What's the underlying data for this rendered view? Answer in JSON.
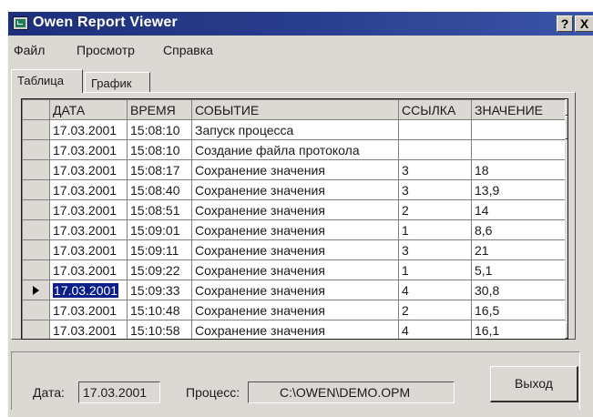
{
  "window": {
    "title": "Owen Report Viewer"
  },
  "titlebar_buttons": {
    "help": "?",
    "close": "X"
  },
  "menu": [
    "Файл",
    "Просмотр",
    "Справка"
  ],
  "tabs": [
    "Таблица",
    "График"
  ],
  "grid": {
    "columns": [
      "ДАТА",
      "ВРЕМЯ",
      "СОБЫТИЕ",
      "ССЫЛКА",
      "ЗНАЧЕНИЕ"
    ],
    "rows": [
      [
        "17.03.2001",
        "15:08:10",
        "Запуск процесса",
        "",
        ""
      ],
      [
        "17.03.2001",
        "15:08:10",
        "Создание файла протокола",
        "",
        ""
      ],
      [
        "17.03.2001",
        "15:08:17",
        "Сохранение значения",
        "3",
        "18"
      ],
      [
        "17.03.2001",
        "15:08:40",
        "Сохранение значения",
        "3",
        "13,9"
      ],
      [
        "17.03.2001",
        "15:08:51",
        "Сохранение значения",
        "2",
        "14"
      ],
      [
        "17.03.2001",
        "15:09:01",
        "Сохранение значения",
        "1",
        "8,6"
      ],
      [
        "17.03.2001",
        "15:09:11",
        "Сохранение значения",
        "3",
        "21"
      ],
      [
        "17.03.2001",
        "15:09:22",
        "Сохранение значения",
        "1",
        "5,1"
      ],
      [
        "17.03.2001",
        "15:09:33",
        "Сохранение значения",
        "4",
        "30,8"
      ],
      [
        "17.03.2001",
        "15:10:48",
        "Сохранение значения",
        "2",
        "16,5"
      ],
      [
        "17.03.2001",
        "15:10:58",
        "Сохранение значения",
        "4",
        "16,1"
      ]
    ],
    "selected_row": 8
  },
  "footer": {
    "date_label": "Дата:",
    "date_value": "17.03.2001",
    "process_label": "Процесс:",
    "process_value": "C:\\OWEN\\DEMO.OPM",
    "exit_label": "Выход"
  }
}
